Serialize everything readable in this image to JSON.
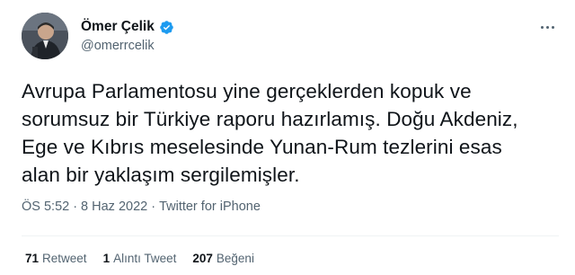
{
  "author": {
    "name": "Ömer Çelik",
    "handle": "@omerrcelik",
    "verified": true
  },
  "tweet": {
    "lines": [
      "Avrupa Parlamentosu yine gerçeklerden kopuk ve",
      "sorumsuz bir Türkiye raporu hazırlamış. Doğu Akdeniz,",
      "Ege ve Kıbrıs meselesinde Yunan-Rum tezlerini esas",
      "alan bir yaklaşım sergilemişler."
    ]
  },
  "meta": {
    "time": "ÖS 5:52",
    "separator1": "·",
    "date": "8 Haz 2022",
    "separator2": "·",
    "source": "Twitter for iPhone"
  },
  "stats": {
    "retweets": {
      "count": "71",
      "label": "Retweet"
    },
    "quotes": {
      "count": "1",
      "label": "Alıntı Tweet"
    },
    "likes": {
      "count": "207",
      "label": "Beğeni"
    }
  },
  "colors": {
    "verified": "#1d9bf0",
    "secondary_text": "#536471",
    "primary_text": "#0f1419"
  },
  "icons": {
    "verified": "verified-badge-icon",
    "more": "more-options-icon"
  }
}
